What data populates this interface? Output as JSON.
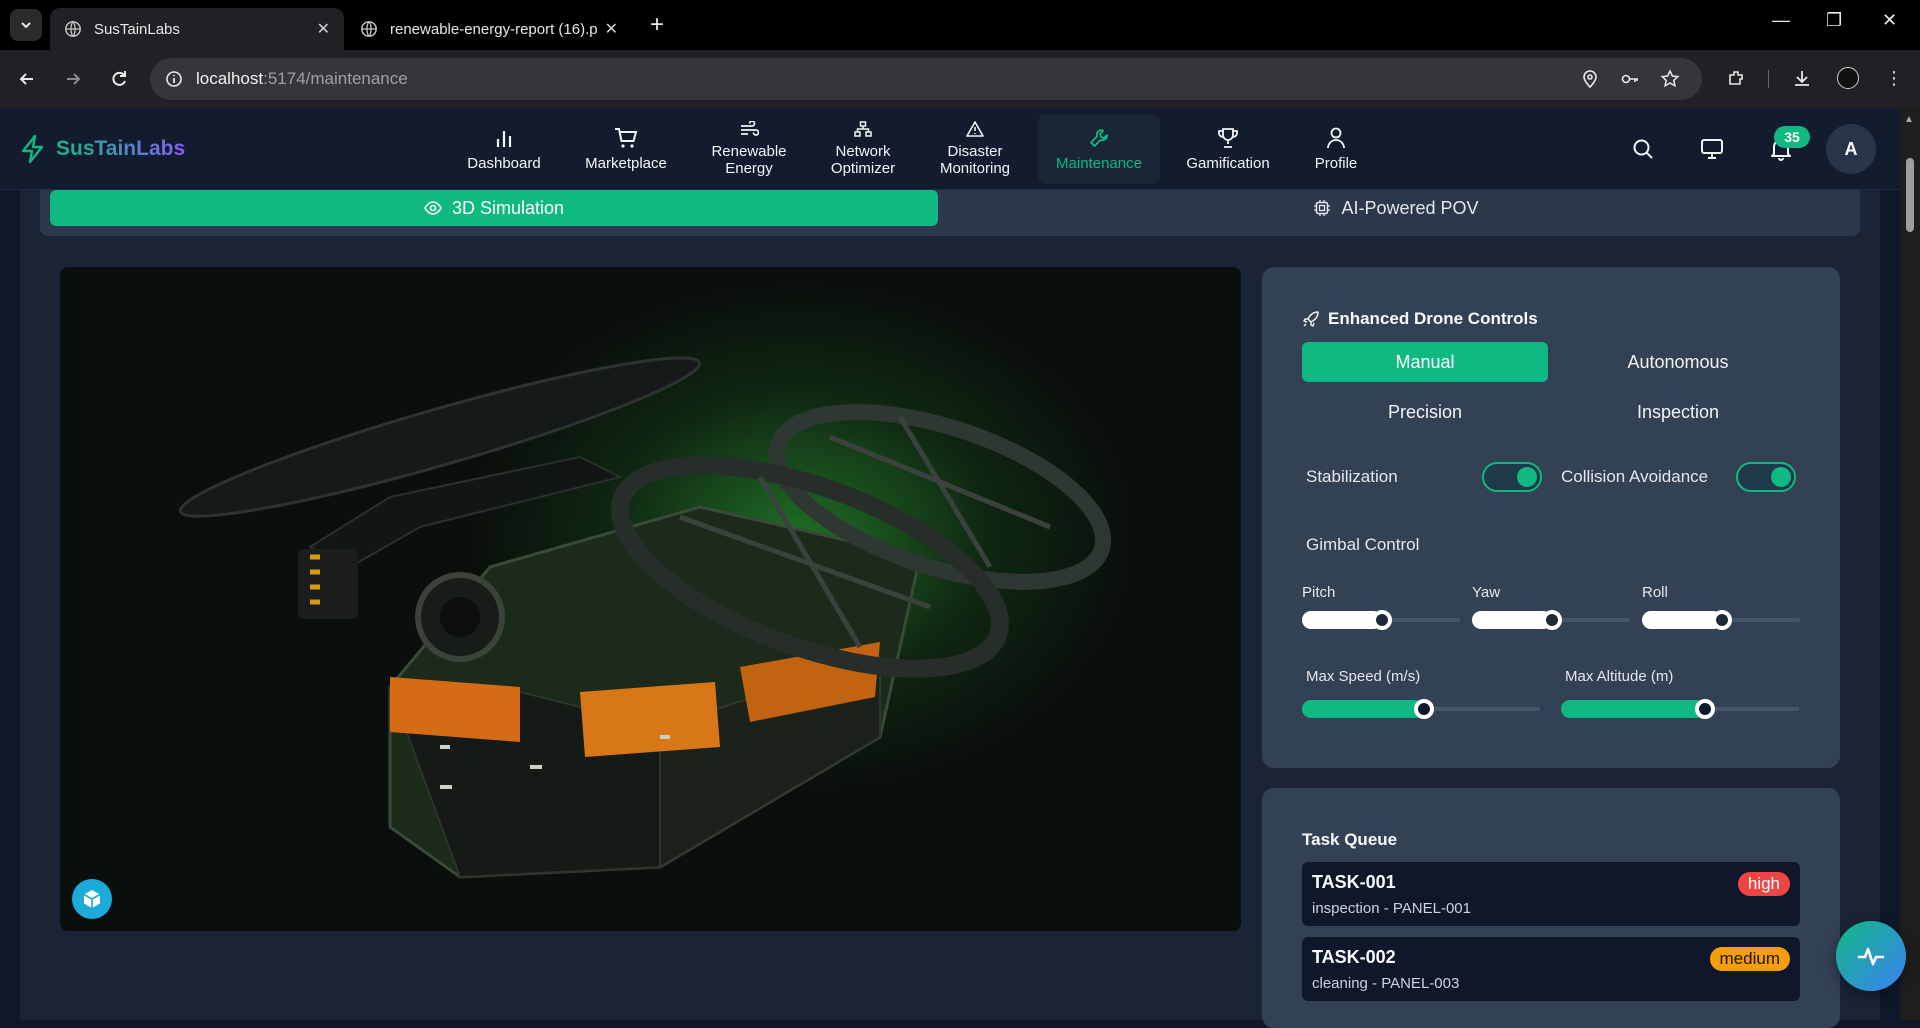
{
  "browser": {
    "tabs": [
      {
        "title": "SusTainLabs",
        "active": true
      },
      {
        "title": "renewable-energy-report (16).p",
        "active": false
      }
    ],
    "url_host": "localhost",
    "url_rest": ":5174/maintenance"
  },
  "app": {
    "brand": "SusTainLabs",
    "nav": [
      {
        "label": "Dashboard",
        "icon": "bar-chart-icon"
      },
      {
        "label": "Marketplace",
        "icon": "cart-icon"
      },
      {
        "label": "Renewable Energy",
        "label_l1": "Renewable",
        "label_l2": "Energy",
        "icon": "wind-icon"
      },
      {
        "label": "Network Optimizer",
        "label_l1": "Network",
        "label_l2": "Optimizer",
        "icon": "network-icon"
      },
      {
        "label": "Disaster Monitoring",
        "label_l1": "Disaster",
        "label_l2": "Monitoring",
        "icon": "alert-triangle-icon"
      },
      {
        "label": "Maintenance",
        "icon": "wrench-icon",
        "active": true
      },
      {
        "label": "Gamification",
        "icon": "trophy-icon"
      },
      {
        "label": "Profile",
        "icon": "user-icon"
      }
    ],
    "notifications_count": "35",
    "avatar_initial": "A",
    "accent": "#10b981"
  },
  "view_tabs": {
    "simulation": "3D Simulation",
    "pov": "AI-Powered POV"
  },
  "drone_controls": {
    "title": "Enhanced Drone Controls",
    "modes": [
      "Manual",
      "Autonomous",
      "Precision",
      "Inspection"
    ],
    "active_mode": "Manual",
    "stabilization_label": "Stabilization",
    "stabilization_on": true,
    "collision_label": "Collision Avoidance",
    "collision_on": true,
    "gimbal_title": "Gimbal Control",
    "gimbal": [
      {
        "label": "Pitch",
        "value": 0.5
      },
      {
        "label": "Yaw",
        "value": 0.5
      },
      {
        "label": "Roll",
        "value": 0.5
      }
    ],
    "max_speed_label": "Max Speed (m/s)",
    "max_speed_value": 0.5,
    "max_altitude_label": "Max Altitude (m)",
    "max_altitude_value": 0.6
  },
  "task_queue": {
    "title": "Task Queue",
    "tasks": [
      {
        "id": "TASK-001",
        "detail": "inspection - PANEL-001",
        "priority": "high"
      },
      {
        "id": "TASK-002",
        "detail": "cleaning - PANEL-003",
        "priority": "medium"
      }
    ]
  }
}
